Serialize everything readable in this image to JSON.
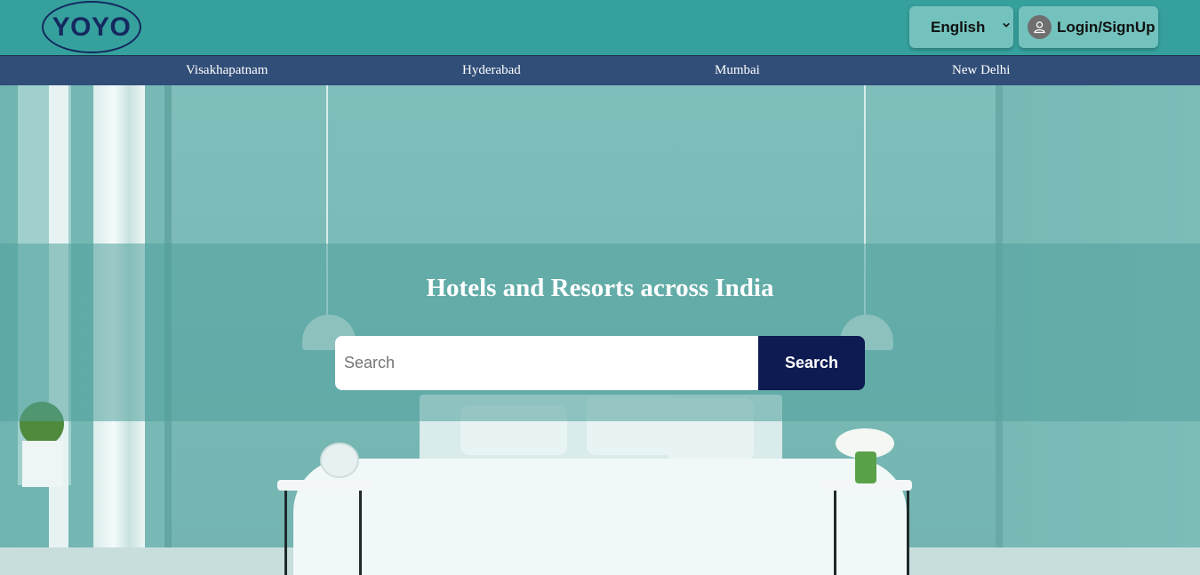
{
  "header": {
    "logo_text": "YOYO",
    "language": {
      "selected": "English"
    },
    "login_label": "Login/SignUp"
  },
  "city_nav": {
    "items": [
      {
        "label": "Visakhapatnam"
      },
      {
        "label": "Hyderabad"
      },
      {
        "label": "Mumbai"
      },
      {
        "label": "New Delhi"
      }
    ]
  },
  "hero": {
    "title": "Hotels and Resorts across India",
    "search": {
      "placeholder": "Search",
      "value": "",
      "button_label": "Search"
    }
  },
  "colors": {
    "header_bg": "#36a09d",
    "nav_bg": "#314e78",
    "logo_color": "#14295f",
    "search_button_bg": "#0e1a52",
    "control_bg": "#73c2bd"
  },
  "icons": {
    "language": "chevron-down-icon",
    "login": "user-icon"
  }
}
